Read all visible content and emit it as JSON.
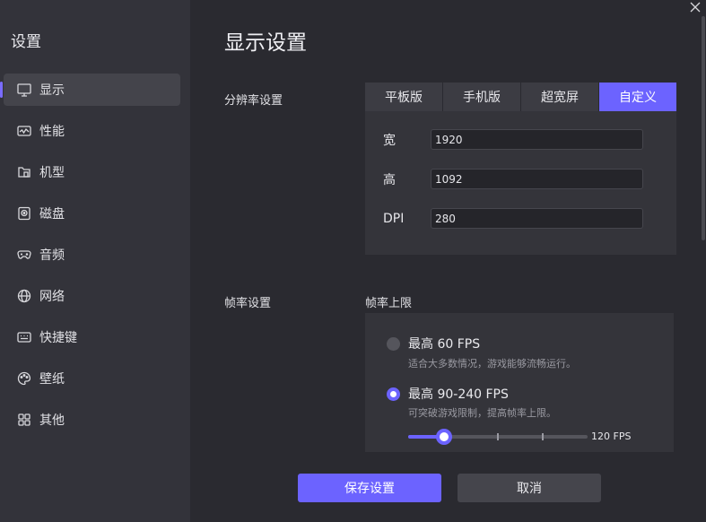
{
  "sidebar": {
    "title": "设置",
    "items": [
      {
        "label": "显示",
        "icon": "monitor-icon",
        "active": true
      },
      {
        "label": "性能",
        "icon": "performance-icon",
        "active": false
      },
      {
        "label": "机型",
        "icon": "device-model-icon",
        "active": false
      },
      {
        "label": "磁盘",
        "icon": "disk-icon",
        "active": false
      },
      {
        "label": "音频",
        "icon": "gamepad-icon",
        "active": false
      },
      {
        "label": "网络",
        "icon": "globe-icon",
        "active": false
      },
      {
        "label": "快捷键",
        "icon": "keyboard-icon",
        "active": false
      },
      {
        "label": "壁纸",
        "icon": "palette-icon",
        "active": false
      },
      {
        "label": "其他",
        "icon": "grid-icon",
        "active": false
      }
    ]
  },
  "main": {
    "title": "显示设置",
    "resolution": {
      "label": "分辨率设置",
      "tabs": [
        {
          "label": "平板版",
          "active": false
        },
        {
          "label": "手机版",
          "active": false
        },
        {
          "label": "超宽屏",
          "active": false
        },
        {
          "label": "自定义",
          "active": true
        }
      ],
      "width_label": "宽",
      "width_value": "1920",
      "height_label": "高",
      "height_value": "1092",
      "dpi_label": "DPI",
      "dpi_value": "280"
    },
    "framerate": {
      "label": "帧率设置",
      "sub_label": "帧率上限",
      "options": [
        {
          "label": "最高 60 FPS",
          "desc": "适合大多数情况，游戏能够流畅运行。",
          "checked": false
        },
        {
          "label": "最高 90-240 FPS",
          "desc": "可突破游戏限制，提高帧率上限。",
          "checked": true
        }
      ],
      "slider_value_label": "120 FPS",
      "slider_fraction": 0.2
    }
  },
  "buttons": {
    "save": "保存设置",
    "cancel": "取消"
  },
  "colors": {
    "accent": "#6c63ff",
    "sidebar_bg": "#33333a",
    "main_bg": "#2a2a30"
  }
}
